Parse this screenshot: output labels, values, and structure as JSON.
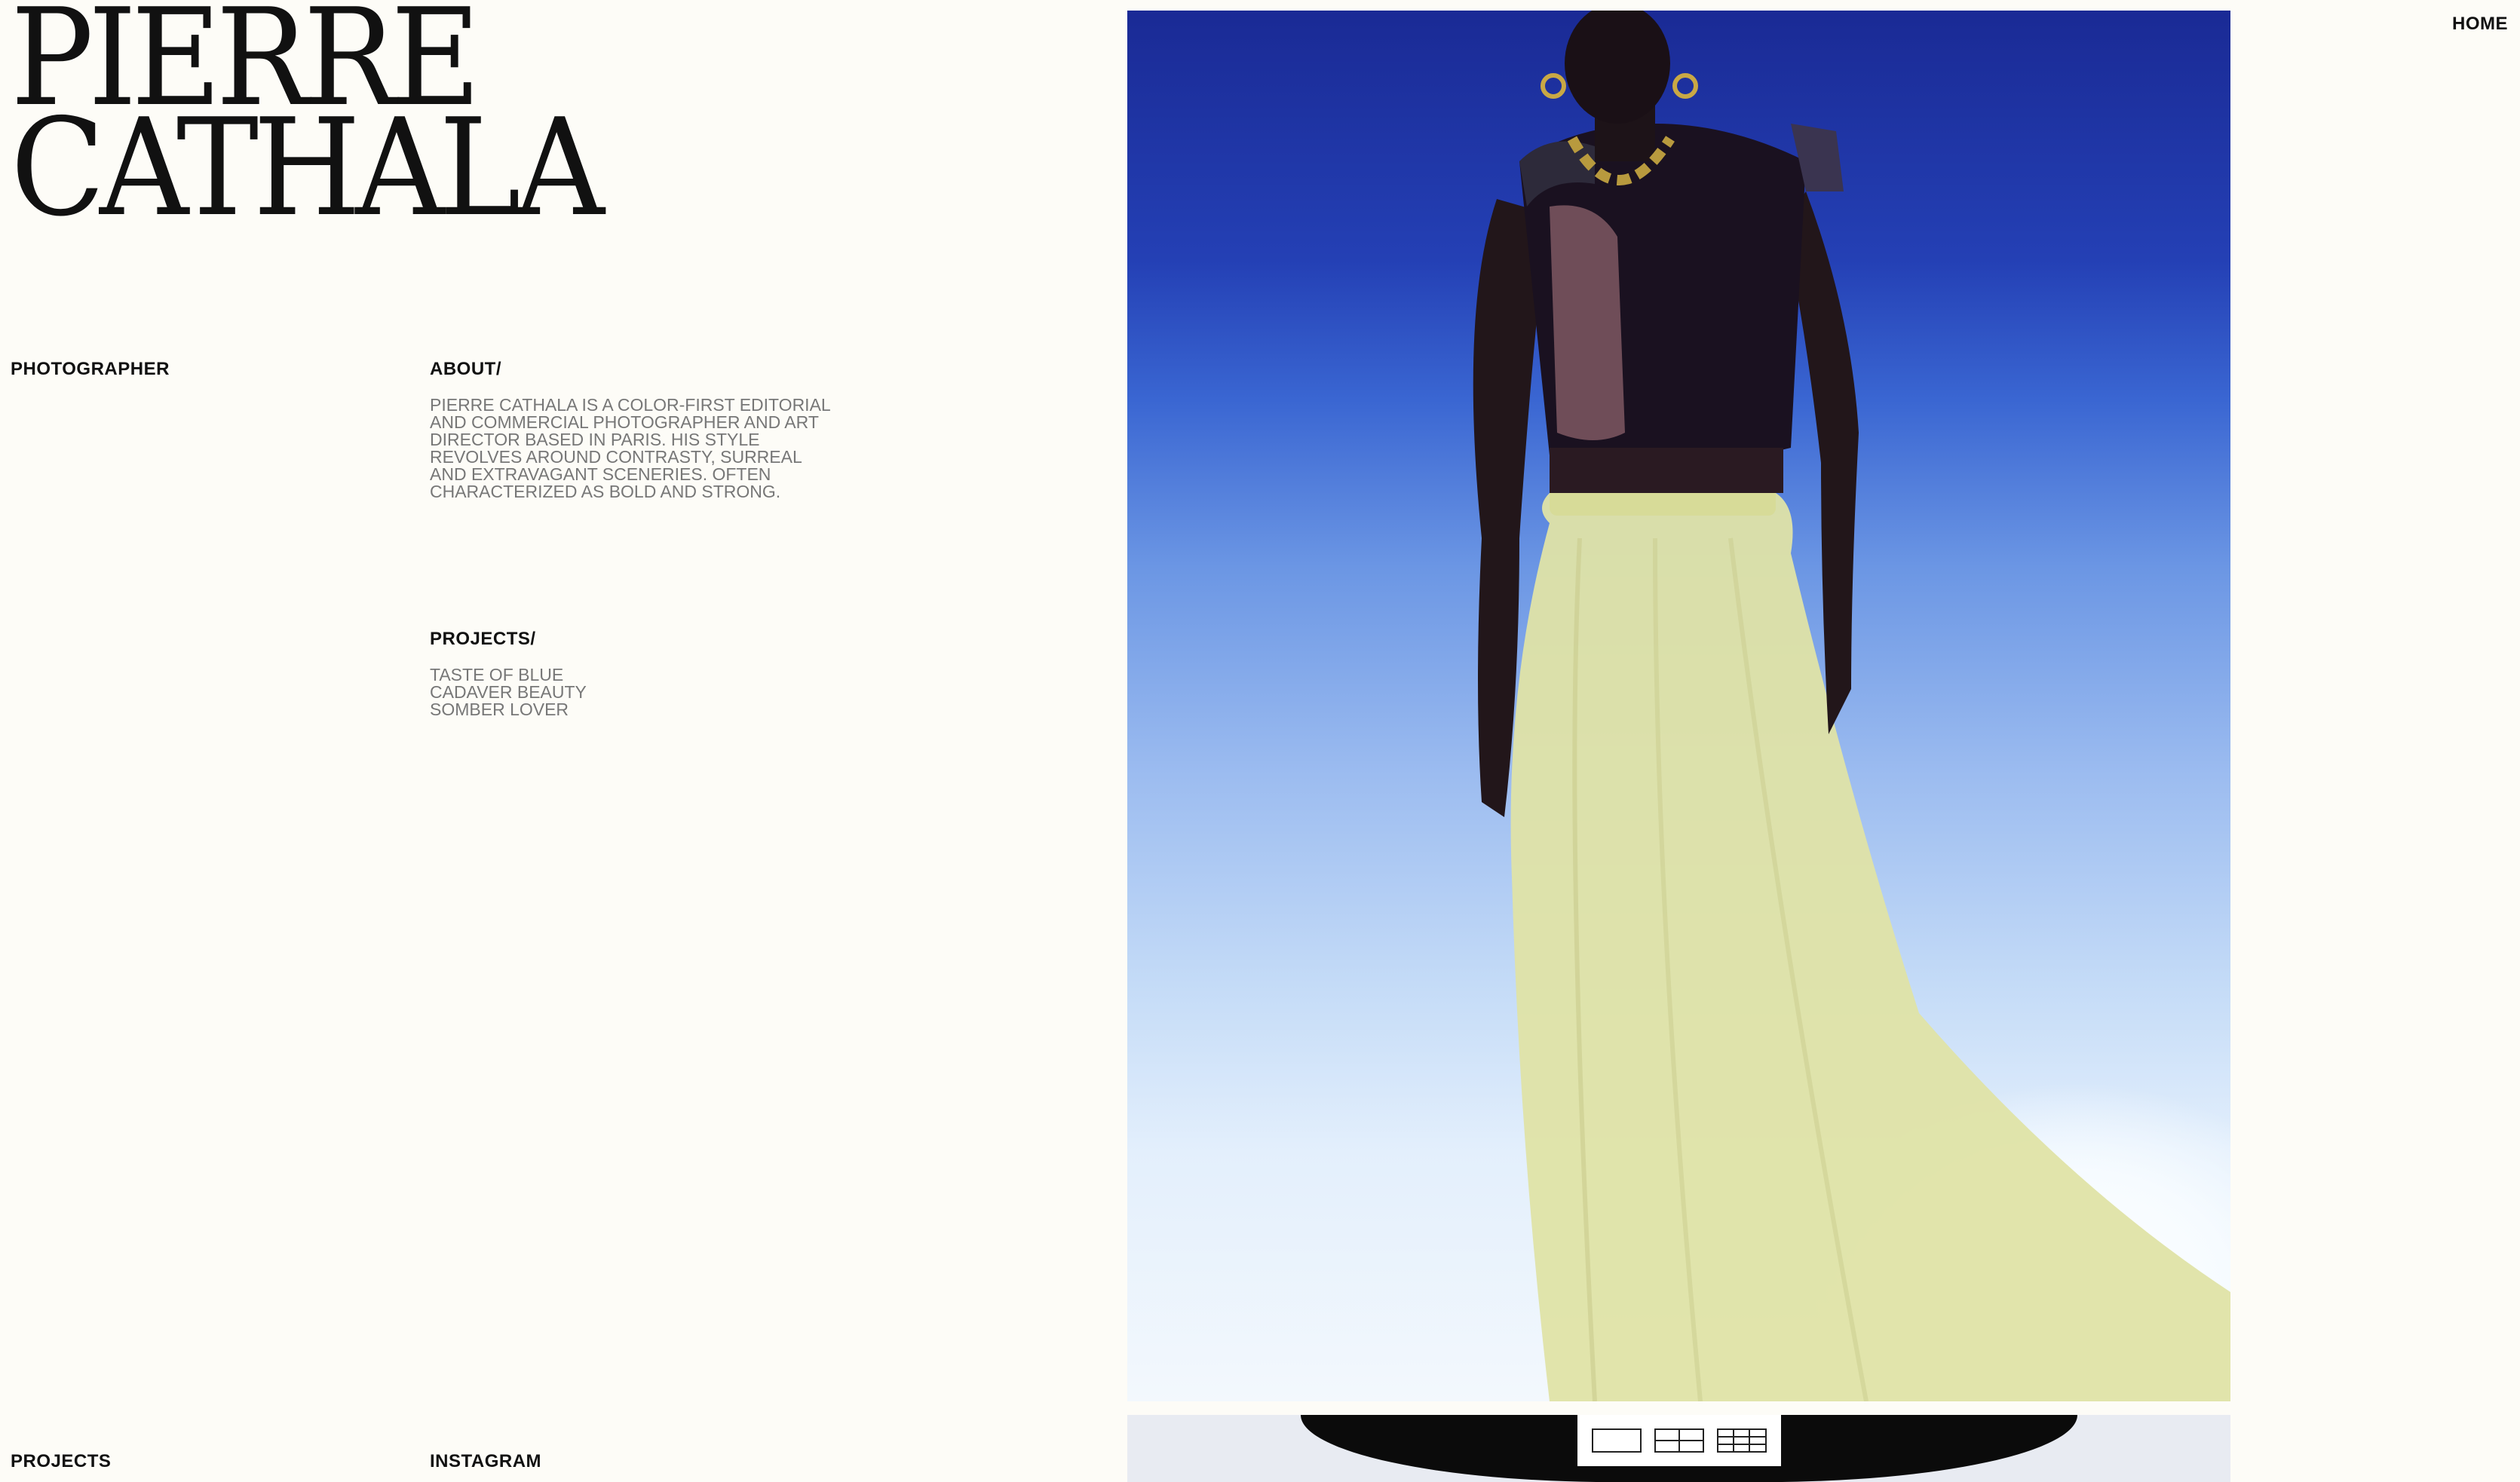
{
  "brand": {
    "line1": "PIERRE",
    "line2": "CATHALA"
  },
  "nav": {
    "home": "HOME"
  },
  "role": "PHOTOGRAPHER",
  "about": {
    "title": "ABOUT/",
    "lines": [
      "PIERRE CATHALA IS A COLOR-FIRST EDITORIAL",
      "AND COMMERCIAL PHOTOGRAPHER AND ART",
      "DIRECTOR BASED IN PARIS. HIS STYLE",
      "REVOLVES AROUND CONTRASTY, SURREAL",
      "AND EXTRAVAGANT SCENERIES. OFTEN",
      "CHARACTERIZED AS BOLD AND STRONG."
    ]
  },
  "projects": {
    "title": "PROJECTS/",
    "items": [
      "TASTE OF BLUE",
      "CADAVER BEAUTY",
      "SOMBER LOVER"
    ]
  },
  "footer": {
    "projects": "PROJECTS",
    "instagram": "INSTAGRAM"
  },
  "view_switcher": {
    "options": [
      "single-view-icon",
      "four-grid-view-icon",
      "nine-grid-view-icon"
    ]
  },
  "colors": {
    "background": "#fdfcf7",
    "text": "#111111",
    "muted_text": "#777777"
  }
}
